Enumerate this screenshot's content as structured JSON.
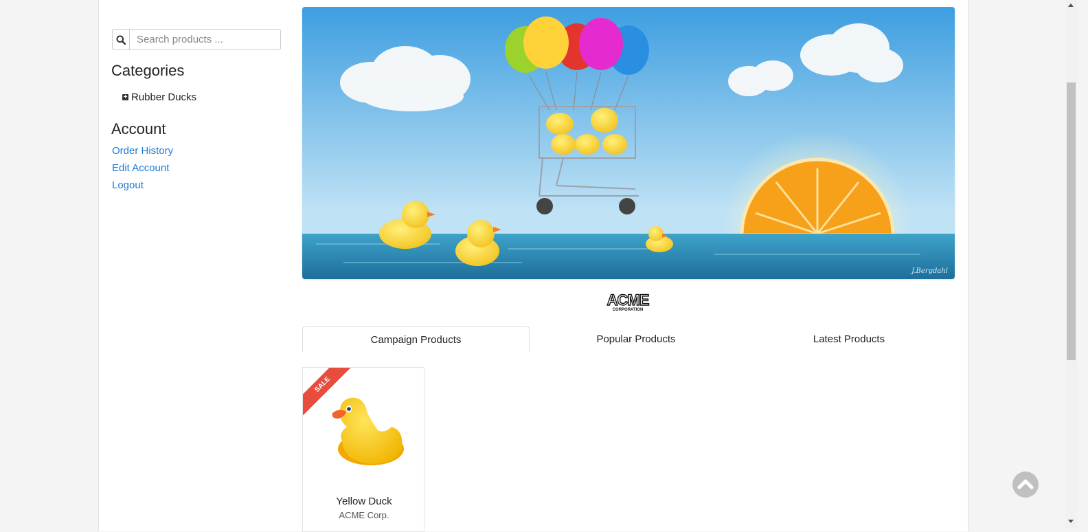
{
  "search": {
    "placeholder": "Search products ...",
    "icon": "search-icon"
  },
  "sidebar": {
    "categories_title": "Categories",
    "categories": [
      {
        "label": "Rubber Ducks",
        "icon": "plus-square-icon"
      }
    ],
    "account_title": "Account",
    "account_links": [
      {
        "label": "Order History"
      },
      {
        "label": "Edit Account"
      },
      {
        "label": "Logout"
      }
    ]
  },
  "banner": {
    "signature": "J.Bergdahl"
  },
  "logo": {
    "text": "ACME",
    "subtext": "CORPORATION"
  },
  "tabs": [
    {
      "label": "Campaign Products",
      "active": true
    },
    {
      "label": "Popular Products",
      "active": false
    },
    {
      "label": "Latest Products",
      "active": false
    }
  ],
  "products": [
    {
      "name": "Yellow Duck",
      "manufacturer": "ACME Corp.",
      "badge": "SALE"
    }
  ],
  "colors": {
    "link": "#1d7ad8",
    "sale": "#e74c3c",
    "sky": "#5aaee8",
    "sea": "#2f86b8"
  }
}
